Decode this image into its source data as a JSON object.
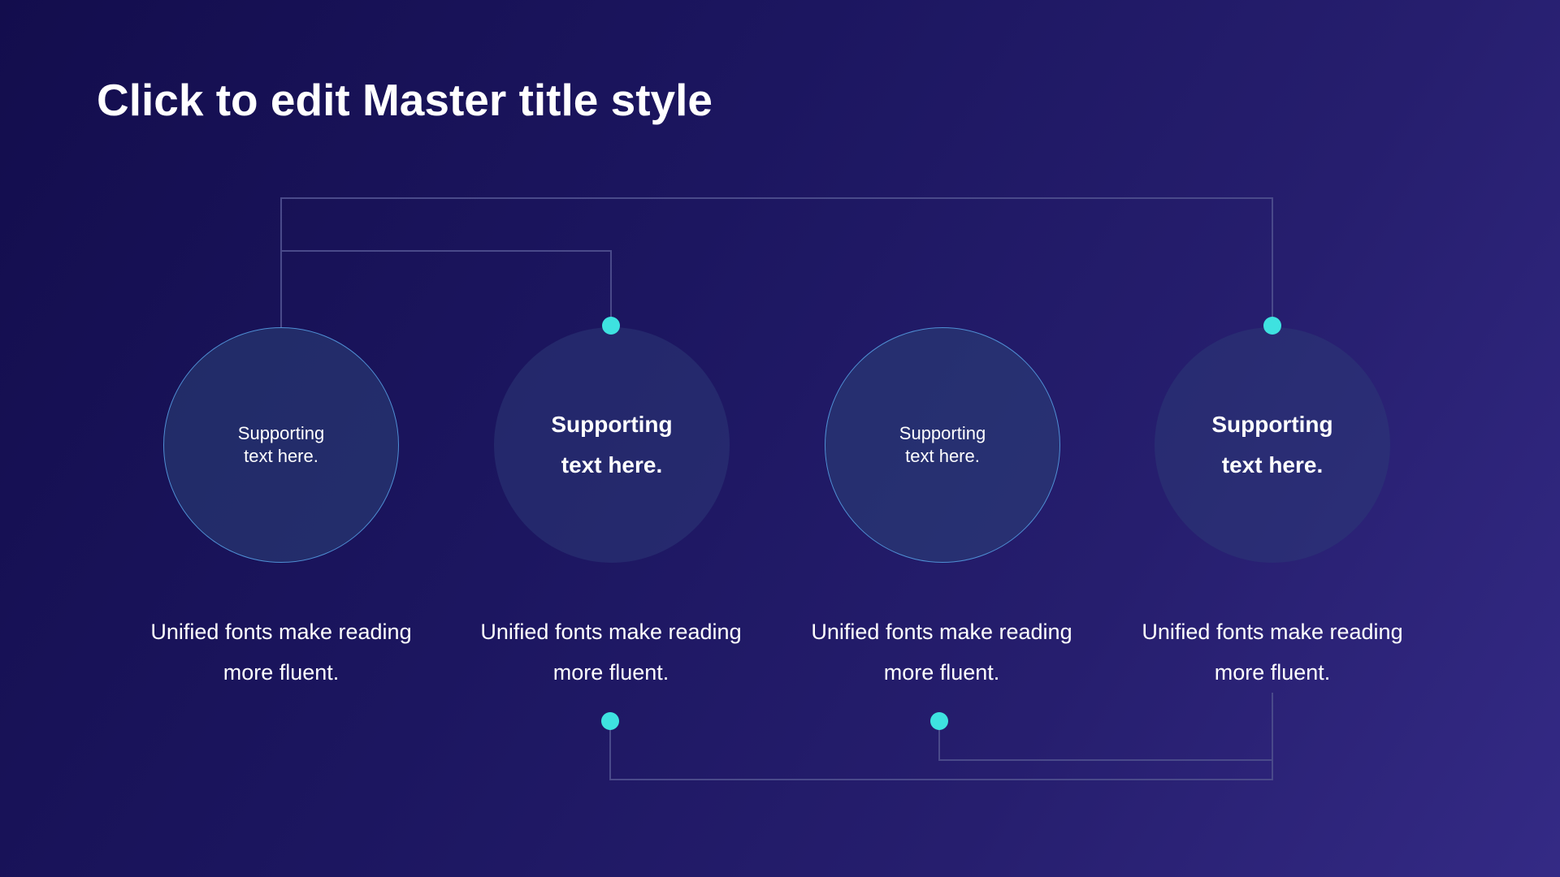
{
  "slide": {
    "title": "Click to edit Master title style"
  },
  "steps": [
    {
      "circle_line1": "Supporting",
      "circle_line2": "text here.",
      "desc_line1": "Unified fonts make reading",
      "desc_line2": "more fluent."
    },
    {
      "circle_line1": "Supporting",
      "circle_line2": "text here.",
      "desc_line1": "Unified fonts make reading",
      "desc_line2": "more fluent."
    },
    {
      "circle_line1": "Supporting",
      "circle_line2": "text here.",
      "desc_line1": "Unified fonts make reading",
      "desc_line2": "more fluent."
    },
    {
      "circle_line1": "Supporting",
      "circle_line2": "text here.",
      "desc_line1": "Unified fonts make reading",
      "desc_line2": "more fluent."
    }
  ],
  "colors": {
    "accent_dot": "#3ee2e0",
    "circle_outline": "#4f8fd4",
    "connector_line": "#4a4a8a"
  }
}
